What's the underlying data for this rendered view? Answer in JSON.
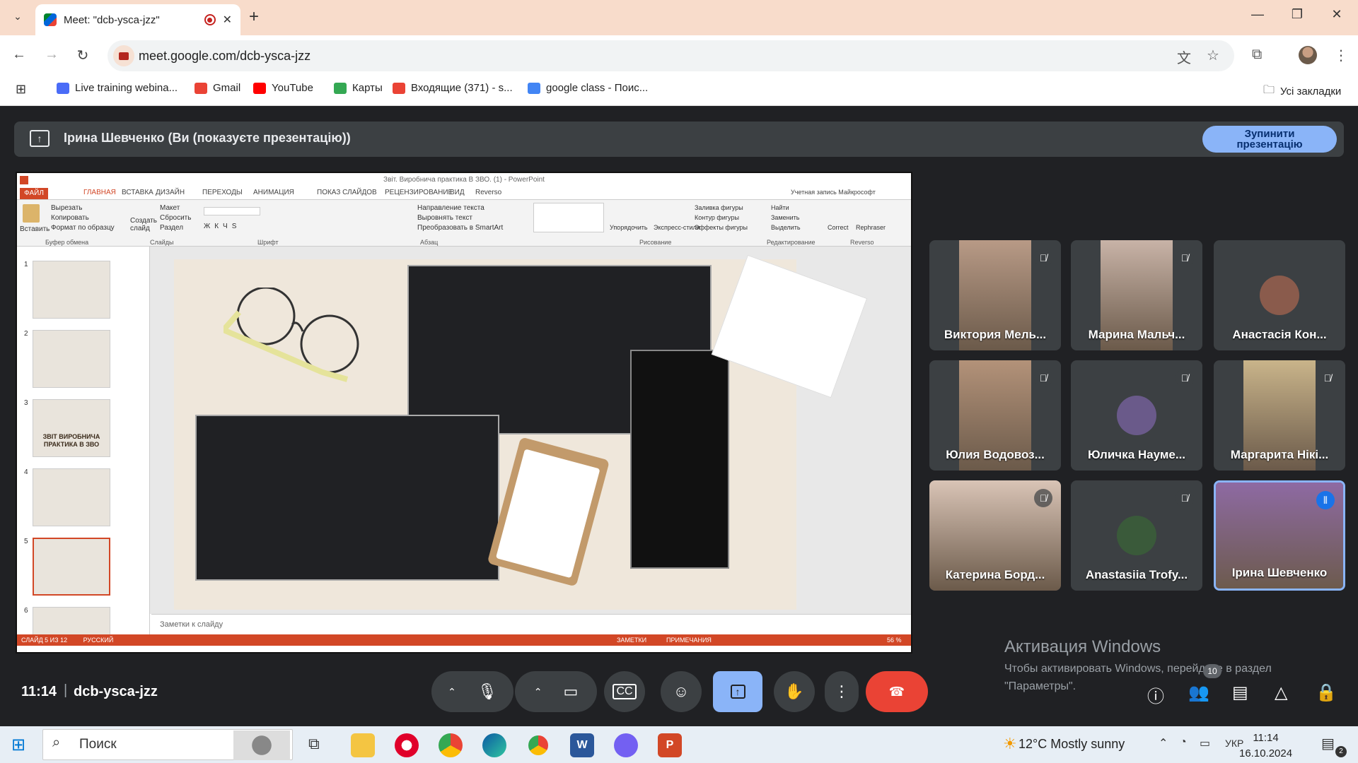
{
  "browser": {
    "tab_title": "Meet: \"dcb-ysca-jzz\"",
    "url": "meet.google.com/dcb-ysca-jzz",
    "bookmarks": [
      {
        "label": "Live training webina...",
        "color": "#4a6cf7"
      },
      {
        "label": "Gmail",
        "color": "#ea4335"
      },
      {
        "label": "YouTube",
        "color": "#ff0000"
      },
      {
        "label": "Карты",
        "color": "#34a853"
      },
      {
        "label": "Входящие (371) - s...",
        "color": "#ea4335"
      },
      {
        "label": "google class - Поис...",
        "color": "#4285f4"
      }
    ],
    "all_bookmarks": "Усі закладки"
  },
  "meet": {
    "banner_text": "Ірина Шевченко (Ви (показуєте презентацію))",
    "stop_button_line1": "Зупинити",
    "stop_button_line2": "презентацію",
    "time": "11:14",
    "separator": "|",
    "meeting_code": "dcb-ysca-jzz",
    "people_count": "10",
    "activate_title": "Активация Windows",
    "activate_text": "Чтобы активировать Windows, перейдите в раздел \"Параметры\".",
    "participants": [
      {
        "name": "Виктория Мель...",
        "muted": true,
        "video": true,
        "color": "#b89a86"
      },
      {
        "name": "Марина Мальч...",
        "muted": true,
        "video": true,
        "color": "#c8b3a7"
      },
      {
        "name": "Анастасія Кон...",
        "muted": false,
        "video": false,
        "color": "#8a5b4c"
      },
      {
        "name": "Юлия Водовоз...",
        "muted": true,
        "video": true,
        "color": "#b39279"
      },
      {
        "name": "Юличка Науме...",
        "muted": true,
        "video": false,
        "color": "#6a5a8a"
      },
      {
        "name": "Маргарита Нікі...",
        "muted": true,
        "video": true,
        "color": "#c9b48a"
      },
      {
        "name": "Катерина Борд...",
        "muted": true,
        "video": true,
        "color": "#d9c4b6"
      },
      {
        "name": "Anastasiia Trofy...",
        "muted": true,
        "video": false,
        "color": "#3a5a3a"
      },
      {
        "name": "Ірина Шевченко",
        "muted": false,
        "video": true,
        "color": "#8e6aa3",
        "speaking": true
      }
    ]
  },
  "ppt": {
    "title": "Звіт. Виробнича практика В ЗВО. (1) - PowerPoint",
    "account": "Учетная запись Майкрософт",
    "tabs": [
      "ФАЙЛ",
      "ГЛАВНАЯ",
      "ВСТАВКА",
      "ДИЗАЙН",
      "ПЕРЕХОДЫ",
      "АНИМАЦИЯ",
      "ПОКАЗ СЛАЙДОВ",
      "РЕЦЕНЗИРОВАНИЕ",
      "ВИД",
      "Reverso"
    ],
    "groups": [
      "Буфер обмена",
      "Слайды",
      "Шрифт",
      "Абзац",
      "Рисование",
      "Редактирование",
      "Reverso"
    ],
    "ribbon": {
      "paste": "Вставить",
      "cut": "Вырезать",
      "copy": "Копировать",
      "format": "Формат по образцу",
      "create": "Создать слайд",
      "layout": "Макет",
      "reset": "Сбросить",
      "section": "Раздел",
      "text_dir": "Направление текста",
      "align_text": "Выровнять текст",
      "smartart": "Преобразовать в SmartArt",
      "arrange": "Упорядочить",
      "quick": "Экспресс-стили",
      "fill": "Заливка фигуры",
      "outline": "Контур фигуры",
      "effects": "Эффекты фигуры",
      "find": "Найти",
      "replace": "Заменить",
      "select": "Выделить",
      "correct": "Correct",
      "rephraser": "Rephraser"
    },
    "thumb1_title": "ЗВІТ ВИРОБНИЧА ПРАКТИКА В ЗВО",
    "notes_placeholder": "Заметки к слайду",
    "status_left": "СЛАЙД 5 ИЗ 12",
    "status_lang": "РУССКИЙ",
    "status_notes": "ЗАМЕТКИ",
    "status_comments": "ПРИМЕЧАНИЯ",
    "zoom": "56 %",
    "thumb_numbers": [
      "1",
      "2",
      "3",
      "4",
      "5",
      "6"
    ]
  },
  "taskbar": {
    "search": "Поиск",
    "weather": "12°C  Mostly sunny",
    "lang": "УКР",
    "time": "11:14",
    "date": "16.10.2024",
    "notif": "2"
  }
}
